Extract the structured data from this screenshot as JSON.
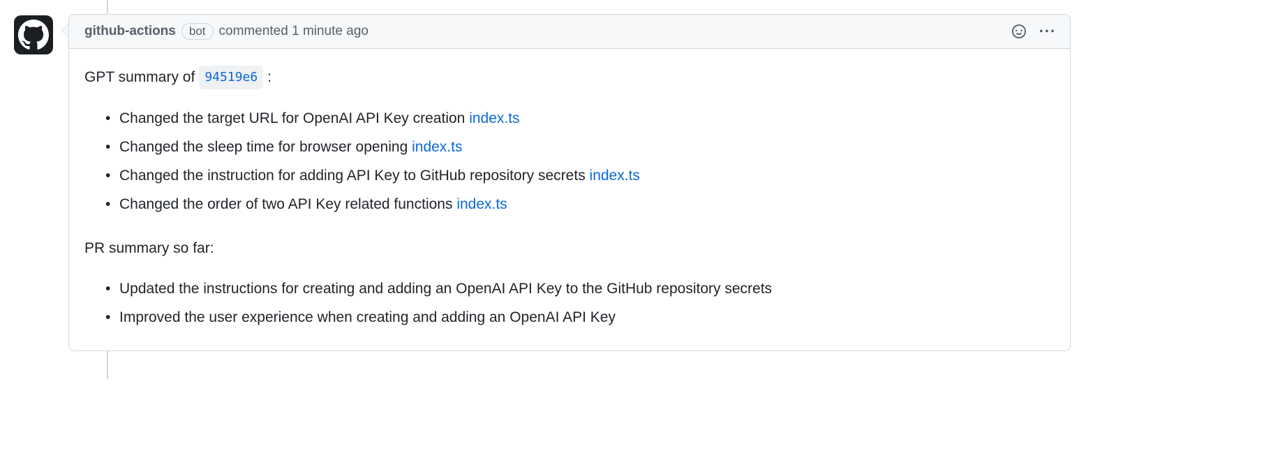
{
  "comment": {
    "author": "github-actions",
    "badge": "bot",
    "action": "commented",
    "timestamp": "1 minute ago",
    "summary_prefix": "GPT summary of",
    "commit_hash": "94519e6",
    "summary_suffix": ":",
    "changes": [
      {
        "text": "Changed the target URL for OpenAI API Key creation ",
        "link": "index.ts"
      },
      {
        "text": "Changed the sleep time for browser opening ",
        "link": "index.ts"
      },
      {
        "text": "Changed the instruction for adding API Key to GitHub repository secrets ",
        "link": "index.ts"
      },
      {
        "text": "Changed the order of two API Key related functions ",
        "link": "index.ts"
      }
    ],
    "pr_summary_title": "PR summary so far:",
    "pr_summary": [
      "Updated the instructions for creating and adding an OpenAI API Key to the GitHub repository secrets",
      "Improved the user experience when creating and adding an OpenAI API Key"
    ]
  }
}
